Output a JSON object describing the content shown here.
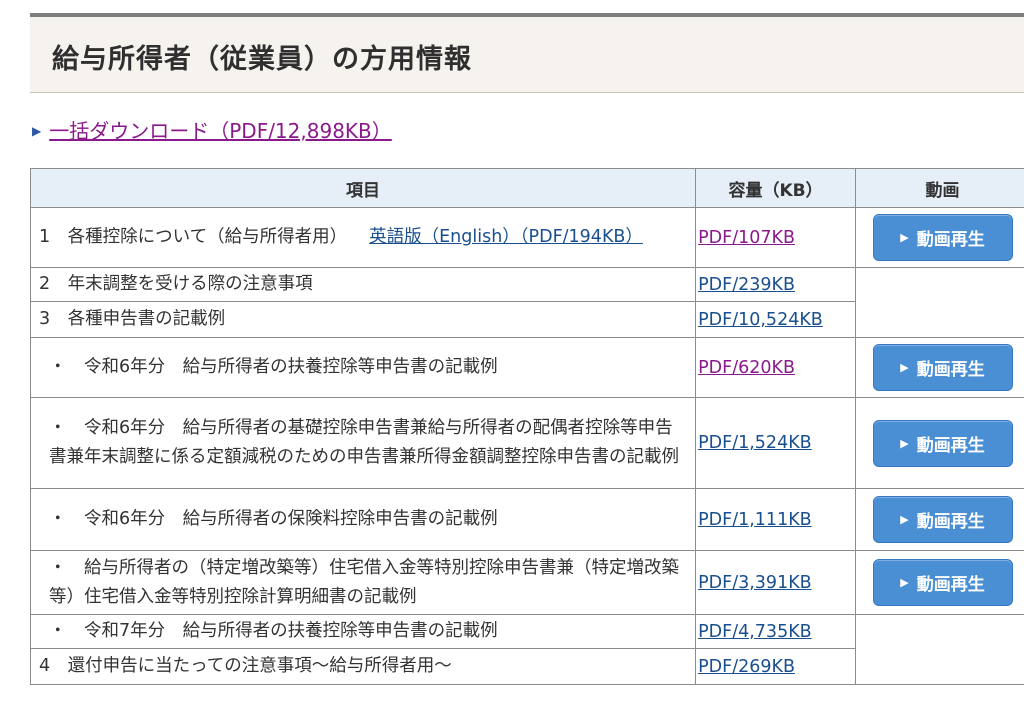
{
  "page": {
    "title": "給与所得者（従業員）の方用情報",
    "bulk_download": "一括ダウンロード（PDF/12,898KB）"
  },
  "table": {
    "headers": {
      "item": "項目",
      "size": "容量（KB）",
      "video": "動画"
    },
    "play_label": "動画再生",
    "rows": [
      {
        "text": "1　各種控除について（給与所得者用）",
        "extra": "英語版（English）（PDF/194KB）",
        "size": "PDF/107KB"
      },
      {
        "text": "2　年末調整を受ける際の注意事項",
        "size": "PDF/239KB"
      },
      {
        "text": "3　各種申告書の記載例",
        "size": "PDF/10,524KB"
      },
      {
        "text": "・　令和6年分　給与所得者の扶養控除等申告書の記載例",
        "size": "PDF/620KB"
      },
      {
        "text": "・　令和6年分　給与所得者の基礎控除申告書兼給与所得者の配偶者控除等申告書兼年末調整に係る定額減税のための申告書兼所得金額調整控除申告書の記載例",
        "size": "PDF/1,524KB"
      },
      {
        "text": "・　令和6年分　給与所得者の保険料控除申告書の記載例",
        "size": "PDF/1,111KB"
      },
      {
        "text": "・　給与所得者の（特定増改築等）住宅借入金等特別控除申告書兼（特定増改築等）住宅借入金等特別控除計算明細書の記載例",
        "size": "PDF/3,391KB"
      },
      {
        "text": "・　令和7年分　給与所得者の扶養控除等申告書の記載例",
        "size": "PDF/4,735KB"
      },
      {
        "text": "4　還付申告に当たっての注意事項～給与所得者用～",
        "size": "PDF/269KB"
      }
    ]
  },
  "colors": {
    "link_visited": "#8a1a8c",
    "link": "#1a4f8f",
    "button": "#4a8ed4",
    "header_bg": "#e6eef8"
  },
  "icons": {
    "bullet": "play-triangle-icon"
  }
}
